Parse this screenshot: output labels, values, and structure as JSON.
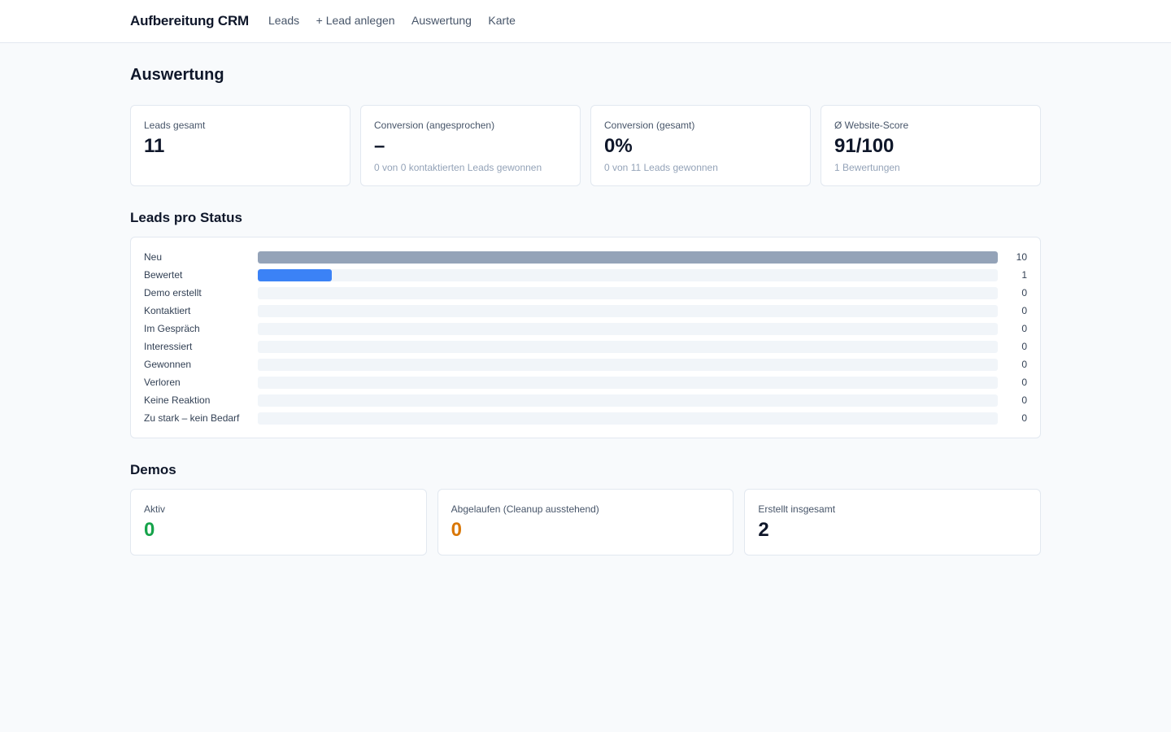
{
  "app": {
    "title": "Aufbereitung CRM",
    "nav": [
      {
        "label": "Leads"
      },
      {
        "label": "+ Lead anlegen"
      },
      {
        "label": "Auswertung"
      },
      {
        "label": "Karte"
      }
    ]
  },
  "page": {
    "title": "Auswertung"
  },
  "kpis": [
    {
      "label": "Leads gesamt",
      "value": "11",
      "sub": ""
    },
    {
      "label": "Conversion (angesprochen)",
      "value": "–",
      "sub": "0 von 0 kontaktierten Leads gewonnen"
    },
    {
      "label": "Conversion (gesamt)",
      "value": "0%",
      "sub": "0 von 11 Leads gewonnen"
    },
    {
      "label": "Ø Website-Score",
      "value": "91/100",
      "sub": "1 Bewertungen"
    }
  ],
  "status": {
    "title": "Leads pro Status",
    "max": 10,
    "rows": [
      {
        "label": "Neu",
        "count": 10,
        "color": "#94a3b8"
      },
      {
        "label": "Bewertet",
        "count": 1,
        "color": "#3b82f6"
      },
      {
        "label": "Demo erstellt",
        "count": 0,
        "color": "#8b5cf6"
      },
      {
        "label": "Kontaktiert",
        "count": 0,
        "color": "#f59e0b"
      },
      {
        "label": "Im Gespräch",
        "count": 0,
        "color": "#06b6d4"
      },
      {
        "label": "Interessiert",
        "count": 0,
        "color": "#10b981"
      },
      {
        "label": "Gewonnen",
        "count": 0,
        "color": "#16a34a"
      },
      {
        "label": "Verloren",
        "count": 0,
        "color": "#ef4444"
      },
      {
        "label": "Keine Reaktion",
        "count": 0,
        "color": "#64748b"
      },
      {
        "label": "Zu stark – kein Bedarf",
        "count": 0,
        "color": "#64748b"
      }
    ]
  },
  "demos": {
    "title": "Demos",
    "cards": [
      {
        "label": "Aktiv",
        "value": "0",
        "color": "#16a34a"
      },
      {
        "label": "Abgelaufen (Cleanup ausstehend)",
        "value": "0",
        "color": "#d97706"
      },
      {
        "label": "Erstellt insgesamt",
        "value": "2",
        "color": "#0f172a"
      }
    ]
  }
}
